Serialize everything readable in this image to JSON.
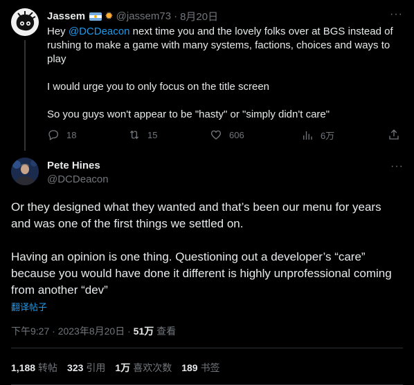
{
  "tweet1": {
    "name": "Jassem",
    "handle": "@jassem73",
    "date": "8月20日",
    "separator": "·",
    "mention": "@DCDeacon",
    "line1_prefix": "Hey ",
    "line1_rest": " next time you and the lovely folks over at BGS instead of rushing to make a game with many systems, factions, choices and ways to play",
    "line2": "I would urge you to only focus on the title screen",
    "line3": "So you guys won't appear to be \"hasty\" or \"simply didn't care\"",
    "replies": "18",
    "retweets": "15",
    "likes": "606",
    "views": "6万",
    "more": "···",
    "icons": {
      "reply": "reply-icon",
      "retweet": "retweet-icon",
      "like": "heart-icon",
      "views": "views-icon",
      "share": "share-icon",
      "flag": "argentina-flag-icon",
      "emoji": "sun-emoji-icon"
    }
  },
  "tweet2": {
    "name": "Pete Hines",
    "handle": "@DCDeacon",
    "more": "···",
    "para1": "Or they designed what they wanted and that’s been our menu for years and was one of the first things we settled on.",
    "para2": "Having an opinion is one thing. Questioning out a developer’s “care” because you would have done it different is highly unprofessional coming from another “dev”",
    "translate": "翻译帖子",
    "time": "下午9:27",
    "date": "2023年8月20日",
    "sep": "·",
    "views_count": "51万",
    "views_label": "查看",
    "stats": {
      "retweets_count": "1,188",
      "retweets_label": "转帖",
      "quotes_count": "323",
      "quotes_label": "引用",
      "likes_count": "1万",
      "likes_label": "喜欢次数",
      "bookmarks_count": "189",
      "bookmarks_label": "书签"
    }
  },
  "colors": {
    "background": "#000000",
    "text": "#e7e9ea",
    "muted": "#71767b",
    "link": "#1d9bf0",
    "divider": "#2f3336"
  }
}
